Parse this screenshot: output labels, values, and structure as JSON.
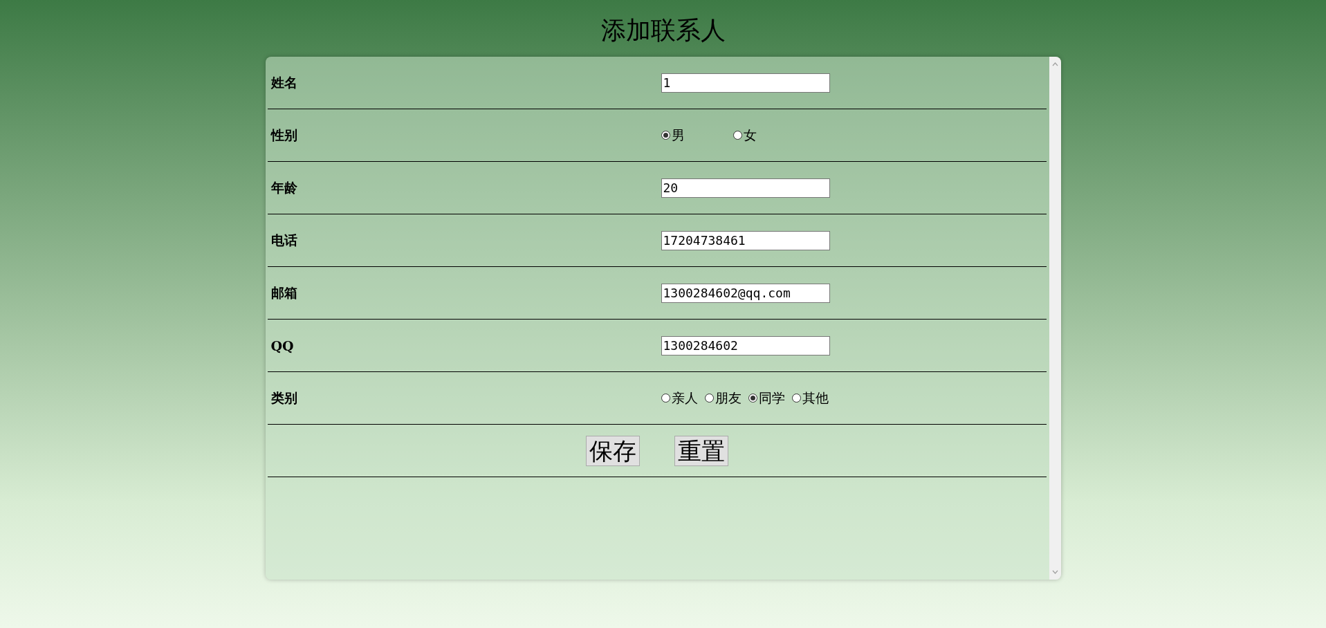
{
  "title": "添加联系人",
  "fields": [
    {
      "kind": "text",
      "label": "姓名",
      "value": "1"
    },
    {
      "kind": "radio",
      "label": "性别",
      "options": [
        {
          "label": "男",
          "selected": true
        },
        {
          "label": "女",
          "selected": false
        }
      ]
    },
    {
      "kind": "text",
      "label": "年龄",
      "value": "20"
    },
    {
      "kind": "text",
      "label": "电话",
      "value": "17204738461"
    },
    {
      "kind": "text",
      "label": "邮箱",
      "value": "1300284602@qq.com"
    },
    {
      "kind": "text",
      "label": "QQ",
      "value": "1300284602"
    },
    {
      "kind": "radio",
      "label": "类别",
      "options": [
        {
          "label": "亲人",
          "selected": false
        },
        {
          "label": "朋友",
          "selected": false
        },
        {
          "label": "同学",
          "selected": true
        },
        {
          "label": "其他",
          "selected": false
        }
      ]
    }
  ],
  "buttons": [
    "保存",
    "重置"
  ]
}
